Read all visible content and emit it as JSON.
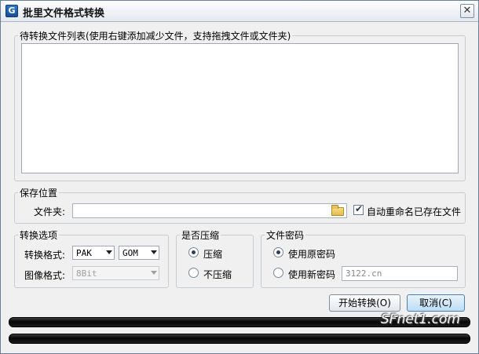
{
  "window": {
    "title": "批里文件格式转换",
    "app_icon": "G"
  },
  "file_list": {
    "legend": "待转换文件列表(使用右键添加减少文件，支持拖拽文件或文件夹)"
  },
  "save_location": {
    "legend": "保存位置",
    "folder_label": "文件夹:",
    "folder_value": "",
    "auto_rename_label": "自动重命名已存在文件",
    "auto_rename_checked": true
  },
  "convert_options": {
    "legend": "转换选项",
    "format_label": "转换格式:",
    "format_from": "PAK",
    "format_to": "GOM",
    "image_format_label": "图像格式:",
    "image_format_value": "8Bit"
  },
  "compression": {
    "legend": "是否压缩",
    "compress_label": "压缩",
    "no_compress_label": "不压缩",
    "selected": "压缩"
  },
  "password": {
    "legend": "文件密码",
    "use_original_label": "使用原密码",
    "use_new_label": "使用新密码",
    "new_password_value": "3122.cn",
    "selected": "使用原密码"
  },
  "buttons": {
    "start": "开始转换(O)",
    "cancel": "取消(C)"
  },
  "progress": {
    "bar1": 0,
    "bar2": 0
  },
  "watermark": "SFnet1.com",
  "colors": {
    "accent": "#3c8ae0",
    "titlebar": "#e4e9ef"
  }
}
